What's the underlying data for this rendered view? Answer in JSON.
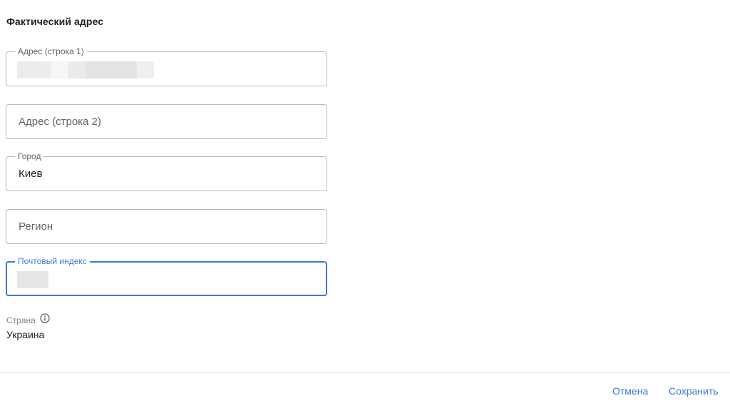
{
  "section": {
    "title": "Фактический адрес"
  },
  "fields": {
    "address_line1": {
      "label": "Адрес (строка 1)",
      "value": ""
    },
    "address_line2": {
      "placeholder": "Адрес (строка 2)"
    },
    "city": {
      "label": "Город",
      "value": "Киев"
    },
    "region": {
      "placeholder": "Регион"
    },
    "postal_code": {
      "label": "Почтовый индекс",
      "value": ""
    }
  },
  "country": {
    "label": "Страна",
    "value": "Украина",
    "icon": "info-icon"
  },
  "actions": {
    "cancel_label": "Отмена",
    "save_label": "Сохранить"
  },
  "colors": {
    "accent": "#3c7ad8",
    "border": "#b7b9bc",
    "label": "#5f6368"
  }
}
